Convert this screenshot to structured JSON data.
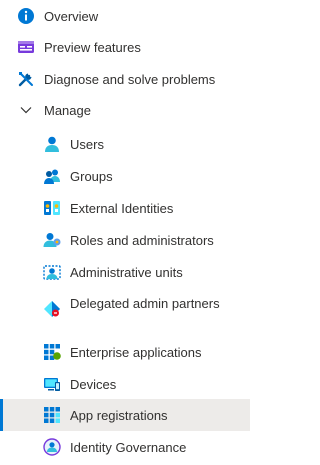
{
  "nav": {
    "overview": "Overview",
    "preview_features": "Preview features",
    "diagnose": "Diagnose and solve problems",
    "manage": "Manage",
    "manage_items": [
      "Users",
      "Groups",
      "External Identities",
      "Roles and administrators",
      "Administrative units",
      "Delegated admin partners",
      "Enterprise applications",
      "Devices",
      "App registrations",
      "Identity Governance"
    ],
    "selected": "App registrations"
  },
  "colors": {
    "accent": "#0078d4",
    "selected_bg": "#edebe9",
    "text": "#323130"
  },
  "icons": [
    "info-icon",
    "preview-features-icon",
    "wrench-screwdriver-icon",
    "chevron-down-icon",
    "user-icon",
    "groups-icon",
    "external-identities-icon",
    "roles-icon",
    "administrative-units-icon",
    "delegated-admin-icon",
    "enterprise-apps-icon",
    "devices-icon",
    "app-registrations-icon",
    "identity-governance-icon"
  ]
}
